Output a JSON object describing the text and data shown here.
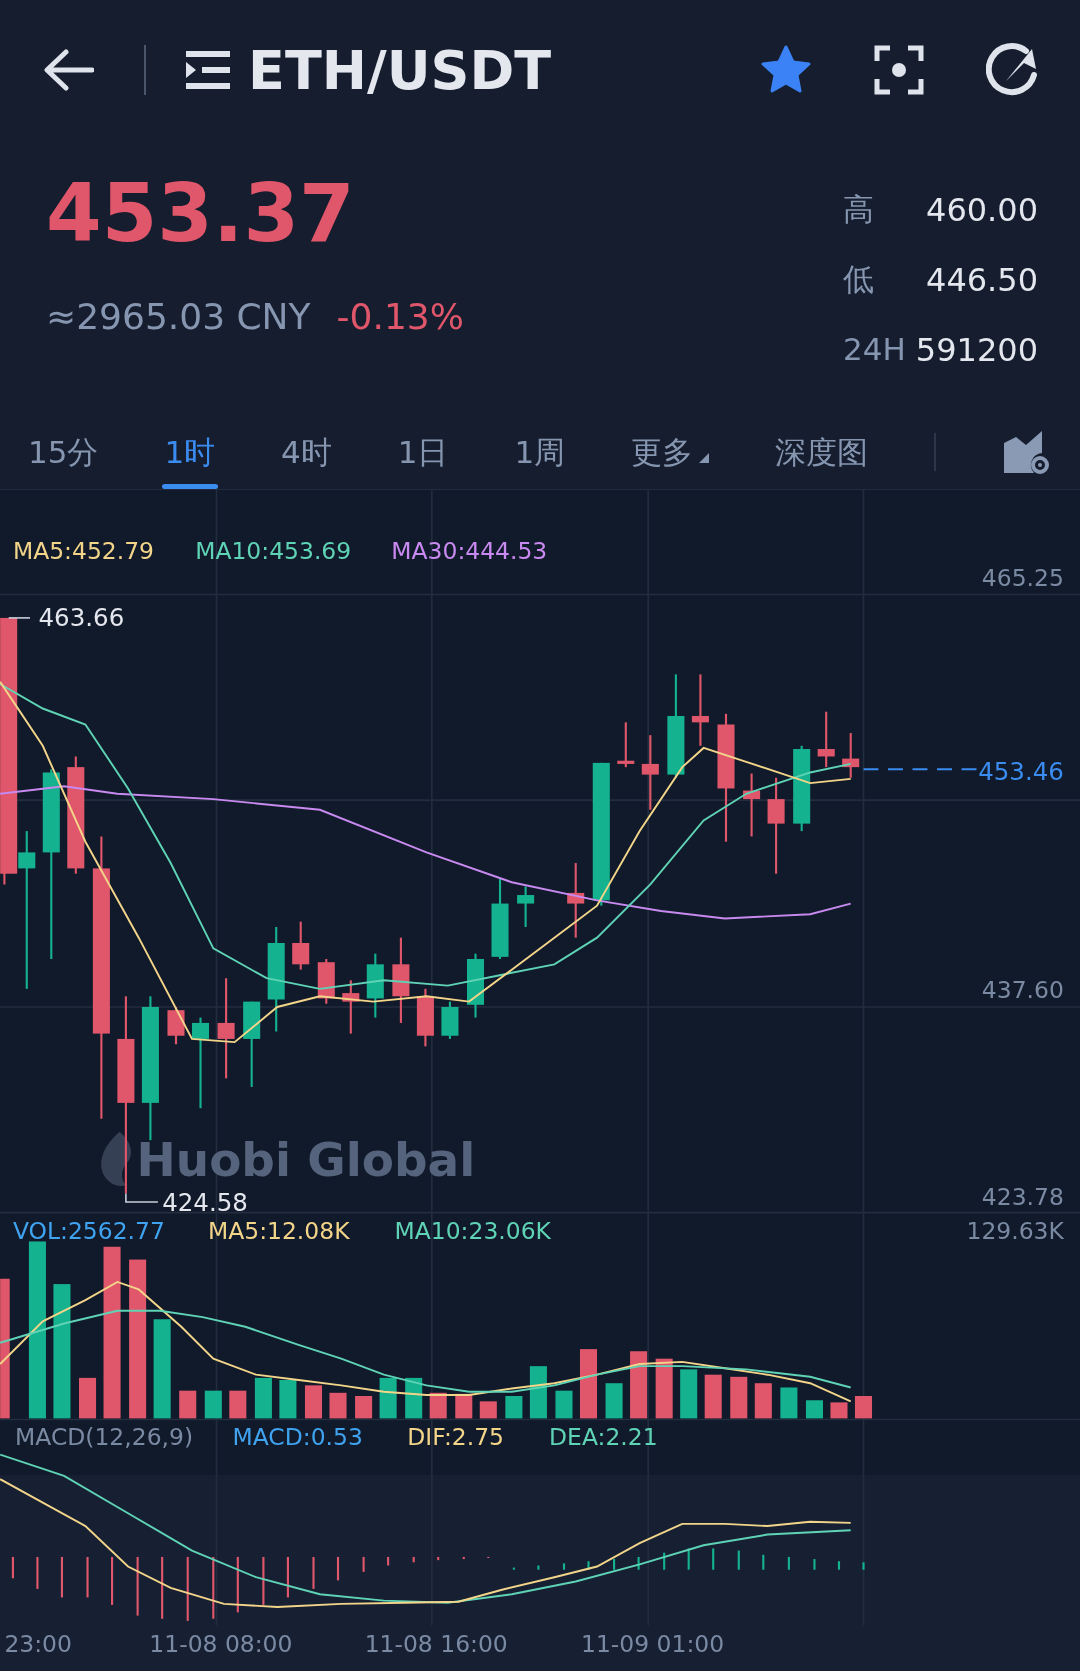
{
  "header": {
    "title": "ETH/USDT",
    "favorite": true
  },
  "price": {
    "last": "453.37",
    "cny": "≈2965.03 CNY",
    "change": "-0.13%"
  },
  "stats": [
    {
      "label": "高",
      "value": "460.00"
    },
    {
      "label": "低",
      "value": "446.50"
    },
    {
      "label": "24H",
      "value": "591200"
    }
  ],
  "tabs": [
    {
      "label": "15分",
      "selected": false
    },
    {
      "label": "1时",
      "selected": true
    },
    {
      "label": "4时",
      "selected": false
    },
    {
      "label": "1日",
      "selected": false
    },
    {
      "label": "1周",
      "selected": false
    },
    {
      "label": "更多",
      "selected": false,
      "kind": "dropdown"
    },
    {
      "label": "深度图",
      "selected": false,
      "kind": "plain"
    }
  ],
  "main_chart": {
    "legend": [
      {
        "label": "MA5:452.79",
        "color": "#f3d58a"
      },
      {
        "label": "MA10:453.69",
        "color": "#5fd3b5"
      },
      {
        "label": "MA30:444.53",
        "color": "#c88af0"
      }
    ],
    "y_labels": [
      "465.25",
      "437.60",
      "423.78"
    ],
    "high_marker": "463.66",
    "low_marker": "424.58",
    "last_price": "453.46",
    "watermark": "Huobi Global"
  },
  "volume": {
    "legend": [
      {
        "label": "VOL:2562.77",
        "color": "#3fa3f0"
      },
      {
        "label": "MA5:12.08K",
        "color": "#f3d58a"
      },
      {
        "label": "MA10:23.06K",
        "color": "#5fd3b5"
      }
    ],
    "max_label": "129.63K"
  },
  "macd": {
    "legend": [
      {
        "label": "MACD(12,26,9)",
        "color": "#7b8aa3"
      },
      {
        "label": "MACD:0.53",
        "color": "#3fa3f0"
      },
      {
        "label": "DIF:2.75",
        "color": "#f3d58a"
      },
      {
        "label": "DEA:2.21",
        "color": "#5fd3b5"
      }
    ]
  },
  "time_axis": [
    "23:00",
    "11-08 08:00",
    "11-08 16:00",
    "11-09 01:00"
  ]
}
